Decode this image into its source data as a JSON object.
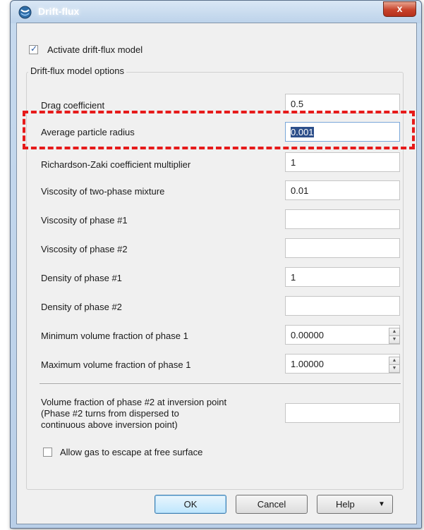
{
  "window": {
    "title": "Drift-flux",
    "close_label": "x"
  },
  "activate": {
    "label": "Activate drift-flux model",
    "checked": true
  },
  "group": {
    "title": "Drift-flux model options"
  },
  "fields": [
    {
      "label": "Drag coefficient",
      "value": "0.5"
    },
    {
      "label": "Average particle radius",
      "value": "0.001"
    },
    {
      "label": "Richardson-Zaki coefficient multiplier",
      "value": "1"
    },
    {
      "label": "Viscosity of two-phase mixture",
      "value": "0.01"
    },
    {
      "label": "Viscosity of phase #1",
      "value": ""
    },
    {
      "label": "Viscosity of phase #2",
      "value": ""
    },
    {
      "label": "Density of phase #1",
      "value": "1"
    },
    {
      "label": "Density of phase #2",
      "value": ""
    },
    {
      "label": "Minimum volume fraction of phase 1",
      "value": "0.00000"
    },
    {
      "label": "Maximum volume fraction of phase 1",
      "value": "1.00000"
    }
  ],
  "inversion": {
    "label_line1": "Volume fraction of phase #2 at inversion point",
    "label_line2": "(Phase #2 turns from dispersed to",
    "label_line3": "continuous above inversion point)",
    "value": ""
  },
  "allow_gas": {
    "label": "Allow gas to escape at free surface",
    "checked": false
  },
  "buttons": {
    "ok": "OK",
    "cancel": "Cancel",
    "help": "Help",
    "help_arrow": "▼"
  },
  "colors": {
    "highlight": "#e61a1a",
    "selection": "#2d4f8a"
  }
}
